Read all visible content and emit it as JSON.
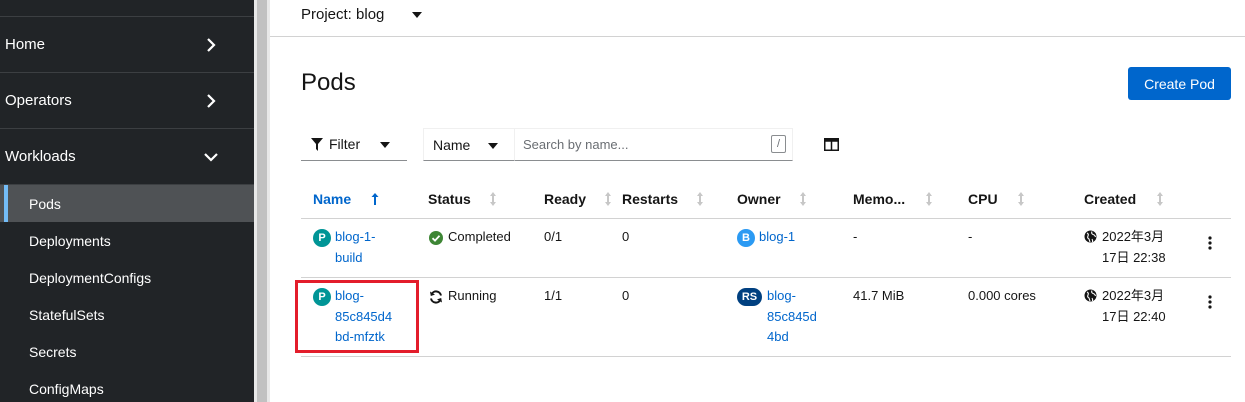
{
  "sidebar": {
    "sections": [
      {
        "label": "Home"
      },
      {
        "label": "Operators"
      },
      {
        "label": "Workloads"
      }
    ],
    "workloads_items": [
      {
        "label": "Pods",
        "active": true
      },
      {
        "label": "Deployments"
      },
      {
        "label": "DeploymentConfigs"
      },
      {
        "label": "StatefulSets"
      },
      {
        "label": "Secrets"
      },
      {
        "label": "ConfigMaps"
      }
    ]
  },
  "project_bar": {
    "label": "Project: blog"
  },
  "page": {
    "title": "Pods",
    "create_button": "Create Pod"
  },
  "toolbar": {
    "filter_label": "Filter",
    "name_select": "Name",
    "search_placeholder": "Search by name...",
    "search_shortcut": "/"
  },
  "table": {
    "columns": [
      "Name",
      "Status",
      "Ready",
      "Restarts",
      "Owner",
      "Memo...",
      "CPU",
      "Created"
    ],
    "rows": [
      {
        "badge": "P",
        "name_lines": [
          "blog-1-",
          "build"
        ],
        "status": "Completed",
        "ready": "0/1",
        "restarts": "0",
        "owner_badge": "B",
        "owner_lines": [
          "blog-1"
        ],
        "memory": "-",
        "cpu": "-",
        "created_lines": [
          "2022年3月",
          "17日 22:38"
        ]
      },
      {
        "badge": "P",
        "name_lines": [
          "blog-",
          "85c845d4",
          "bd-mfztk"
        ],
        "status": "Running",
        "ready": "1/1",
        "restarts": "0",
        "owner_badge": "RS",
        "owner_lines": [
          "blog-",
          "85c845d",
          "4bd"
        ],
        "memory": "41.7 MiB",
        "cpu": "0.000 cores",
        "created_lines": [
          "2022年3月",
          "17日 22:40"
        ]
      }
    ]
  },
  "colors": {
    "sidebar_bg": "#212427",
    "accent": "#0066cc",
    "pod_badge": "#009596",
    "build_badge": "#2b9af3",
    "rs_badge": "#004080",
    "success": "#3e8635",
    "highlight": "#e31d2b"
  }
}
